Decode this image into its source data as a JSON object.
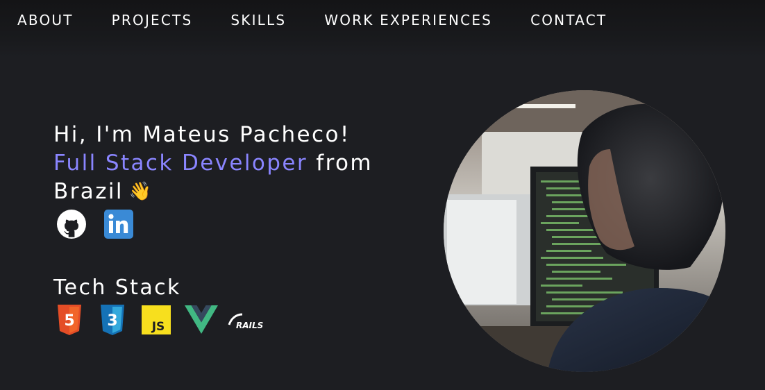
{
  "nav": {
    "items": [
      {
        "label": "ABOUT"
      },
      {
        "label": "PROJECTS"
      },
      {
        "label": "SKILLS"
      },
      {
        "label": "WORK EXPERIENCES"
      },
      {
        "label": "CONTACT"
      }
    ]
  },
  "hero": {
    "greeting": "Hi, I'm Mateus Pacheco!",
    "role": "Full Stack Developer",
    "from_word": "from",
    "country": "Brazil",
    "wave_emoji": "👋",
    "accent_color": "#8a85ff"
  },
  "socials": [
    {
      "icon": "github-icon"
    },
    {
      "icon": "linkedin-icon"
    }
  ],
  "tech_stack": {
    "title": "Tech Stack",
    "items": [
      {
        "icon": "html5-icon",
        "label": "5"
      },
      {
        "icon": "css3-icon",
        "label": "3"
      },
      {
        "icon": "javascript-icon",
        "label": "JS"
      },
      {
        "icon": "vue-icon"
      },
      {
        "icon": "rails-icon",
        "label": "RAILS"
      }
    ]
  },
  "photo": {
    "icon": "developer-at-computer-photo"
  }
}
